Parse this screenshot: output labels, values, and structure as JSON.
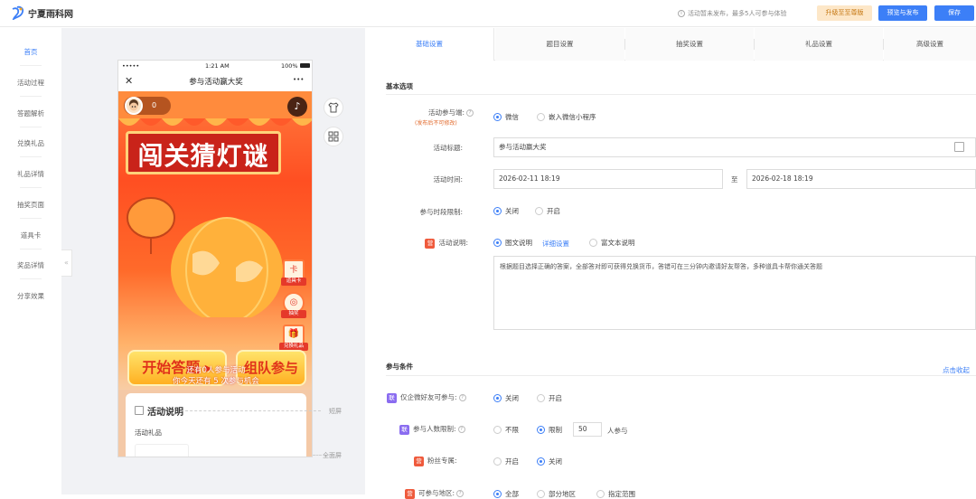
{
  "topbar": {
    "logo_text": "宁夏雨科网",
    "notice": "活动暂未发布，最多5人可参与体验",
    "upgrade_label": "升级至至尊版",
    "preview_label": "预览与发布",
    "save_label": "保存"
  },
  "leftnav": {
    "items": [
      "首页",
      "活动过程",
      "答题解析",
      "兑换礼品",
      "礼品详情",
      "抽奖页面",
      "道具卡",
      "奖品详情",
      "分享效果"
    ],
    "active_index": 0,
    "collapse_glyph": "«"
  },
  "phone": {
    "time": "1:21 AM",
    "carrier": "•••••",
    "battery": "100%",
    "title": "参与活动赢大奖",
    "more": "•••",
    "close": "✕",
    "score": "0",
    "banner_title": "闯关猜灯谜",
    "side_icons": [
      "道具卡",
      "抽奖",
      "兑换礼品"
    ],
    "start_button": "开始答题 ▸",
    "team_button": "组队参与",
    "participants": "还有0人参与活动",
    "chances": "你今天还有 5 次参与机会",
    "card_title": "活动说明",
    "card_sub": "活动礼品"
  },
  "preview_labels": {
    "short_screen": "短屏",
    "full_screen": "全面屏"
  },
  "tabs": [
    "基础设置",
    "题目设置",
    "抽奖设置",
    "礼品设置",
    "高级设置"
  ],
  "active_tab": 0,
  "basic": {
    "section_title": "基本选项",
    "participant_label": "活动参与端:",
    "participant_note": "(发布后不可修改)",
    "participant_options": [
      "微信",
      "嵌入微信小程序"
    ],
    "participant_selected": 0,
    "title_label": "活动标题:",
    "title_value": "参与活动赢大奖",
    "time_label": "活动时间:",
    "time_start": "2026-02-11 18:19",
    "time_to": "至",
    "time_end": "2026-02-18 18:19",
    "period_label": "参与时段限制:",
    "period_options": [
      "关闭",
      "开启"
    ],
    "period_selected": 0,
    "desc_badge": "营",
    "desc_label": "活动说明:",
    "desc_options": [
      "图文说明",
      "富文本说明"
    ],
    "desc_link": "详细设置",
    "desc_selected": 0,
    "desc_text": "根据题目选择正确的答案，全部答对即可获得兑换货币，答错可在三分钟内邀请好友帮答，多种道具卡帮你通关答题"
  },
  "conditions": {
    "section_title": "参与条件",
    "collapse_link": "点击收起",
    "enterprise_badge": "联",
    "enterprise_label": "仅企微好友可参与:",
    "enterprise_options": [
      "关闭",
      "开启"
    ],
    "enterprise_selected": 0,
    "limit_badge": "联",
    "limit_label": "参与人数限制:",
    "limit_options": [
      "不限",
      "限制"
    ],
    "limit_selected": 1,
    "limit_value": "50",
    "limit_unit": "人参与",
    "fans_badge": "营",
    "fans_label": "粉丝专属:",
    "fans_options": [
      "开启",
      "关闭"
    ],
    "fans_selected": 1,
    "region_badge": "营",
    "region_label": "可参与地区:",
    "region_options": [
      "全部",
      "部分地区",
      "指定范围"
    ],
    "region_selected": 0
  },
  "colors": {
    "accent": "#3c7ff7",
    "upgrade_bg": "#fde7c8",
    "poster_red": "#ff4f22",
    "badge_red": "#ef5a3c",
    "badge_purple": "#8a6cf0"
  }
}
